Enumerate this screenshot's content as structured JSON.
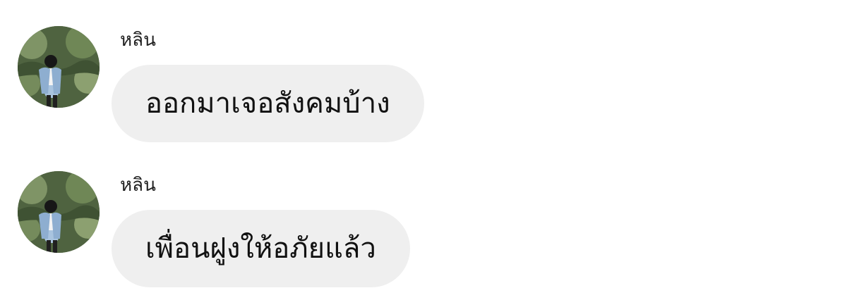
{
  "messages": [
    {
      "sender": "หลิน",
      "text": "ออกมาเจอสังคมบ้าง",
      "avatar_icon": "profile-photo"
    },
    {
      "sender": "หลิน",
      "text": "เพื่อนฝูงให้อภัยแล้ว",
      "avatar_icon": "profile-photo"
    }
  ],
  "colors": {
    "bubble_background": "#efefef",
    "text": "#111111",
    "sender_text": "#1f1f1f",
    "background": "#ffffff"
  }
}
